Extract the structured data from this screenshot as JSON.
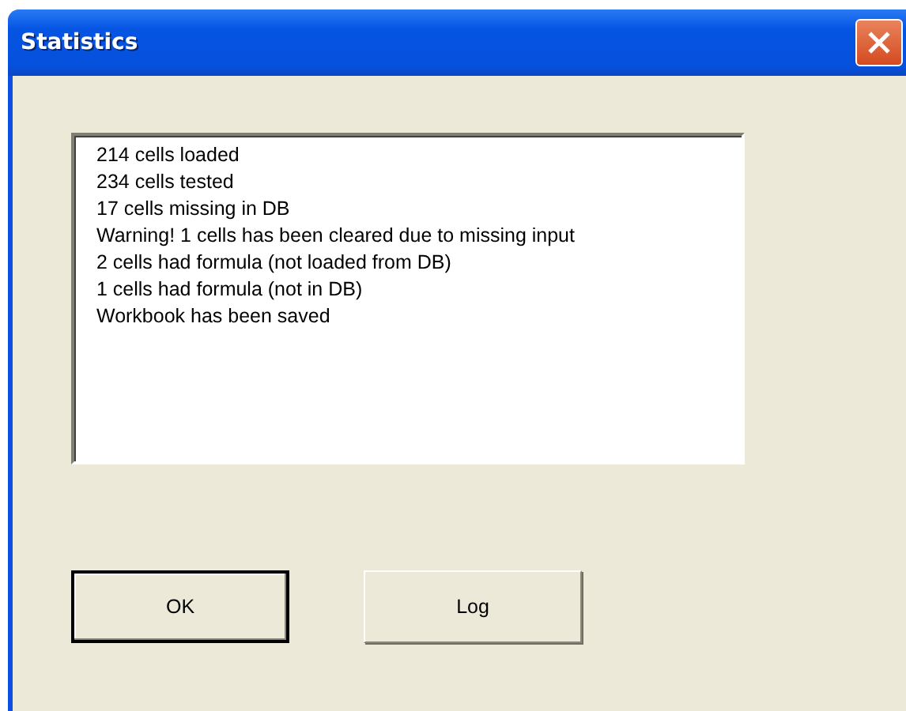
{
  "window": {
    "title": "Statistics"
  },
  "messages": [
    "214 cells loaded",
    "234 cells tested",
    "17 cells missing in DB",
    "Warning! 1 cells has been cleared due to missing input",
    "2 cells had formula (not loaded from DB)",
    "1 cells had formula (not in DB)",
    "Workbook has been saved"
  ],
  "buttons": [
    {
      "label": "OK",
      "default": true
    },
    {
      "label": "Log",
      "default": false
    }
  ]
}
